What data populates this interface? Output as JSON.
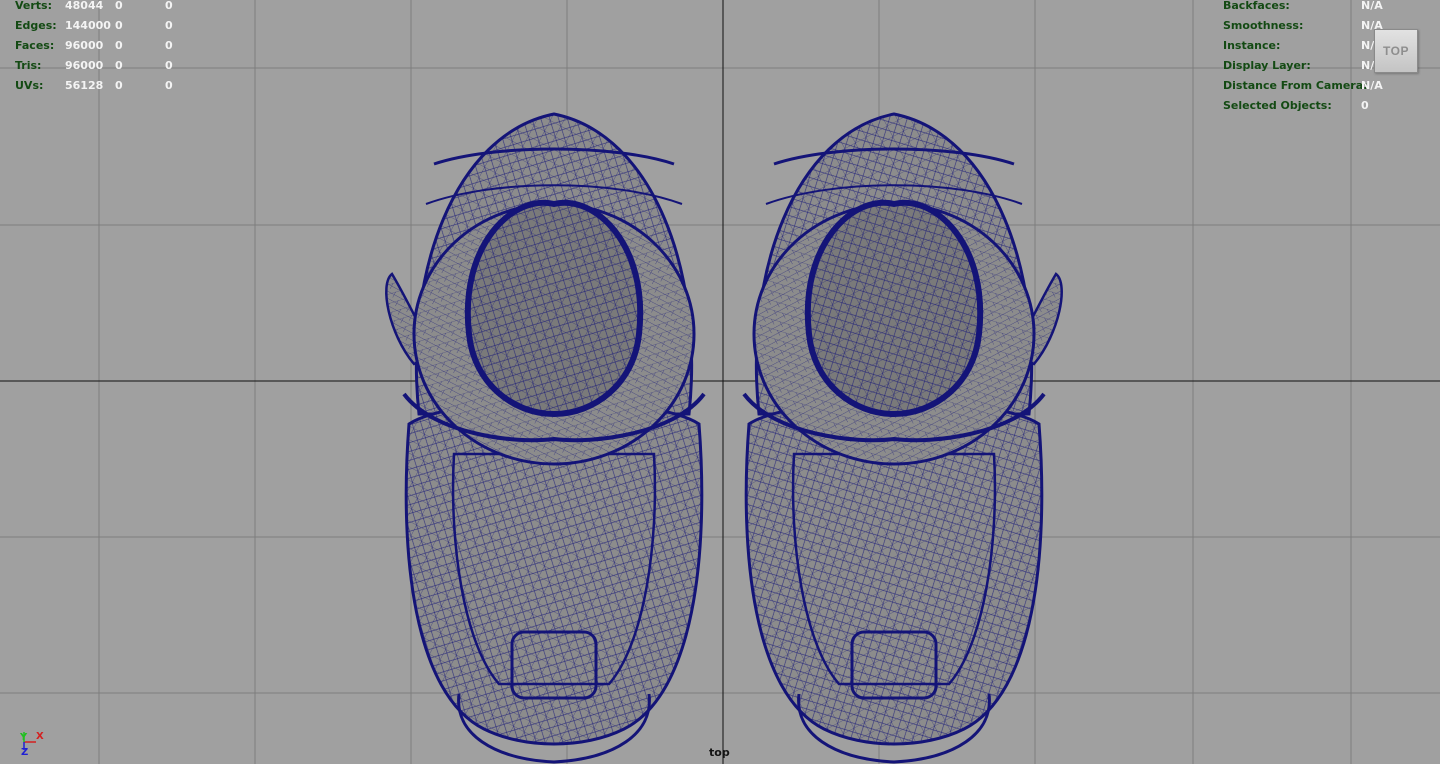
{
  "viewport": {
    "camera_name": "top",
    "viewcube_label": "TOP",
    "background_color": "#a0a0a0",
    "grid_color": "#7e7e7e",
    "axis_line_color": "#111111",
    "wireframe_color": "#141478",
    "shaded_color": "#8c8c8c"
  },
  "poly_stats": [
    {
      "label": "Verts:",
      "values": [
        "48044",
        "0",
        "0"
      ]
    },
    {
      "label": "Edges:",
      "values": [
        "144000",
        "0",
        "0"
      ]
    },
    {
      "label": "Faces:",
      "values": [
        "96000",
        "0",
        "0"
      ]
    },
    {
      "label": "Tris:",
      "values": [
        "96000",
        "0",
        "0"
      ]
    },
    {
      "label": "UVs:",
      "values": [
        "56128",
        "0",
        "0"
      ]
    }
  ],
  "object_stats": [
    {
      "label": "Backfaces:",
      "value": "N/A"
    },
    {
      "label": "Smoothness:",
      "value": "N/A"
    },
    {
      "label": "Instance:",
      "value": "N/A"
    },
    {
      "label": "Display Layer:",
      "value": "N/A"
    },
    {
      "label": "Distance From Camera:",
      "value": "N/A"
    },
    {
      "label": "Selected Objects:",
      "value": "0"
    }
  ],
  "axis_gizmo": {
    "y_label": "Y",
    "x_label": "X",
    "z_label": "Z"
  }
}
